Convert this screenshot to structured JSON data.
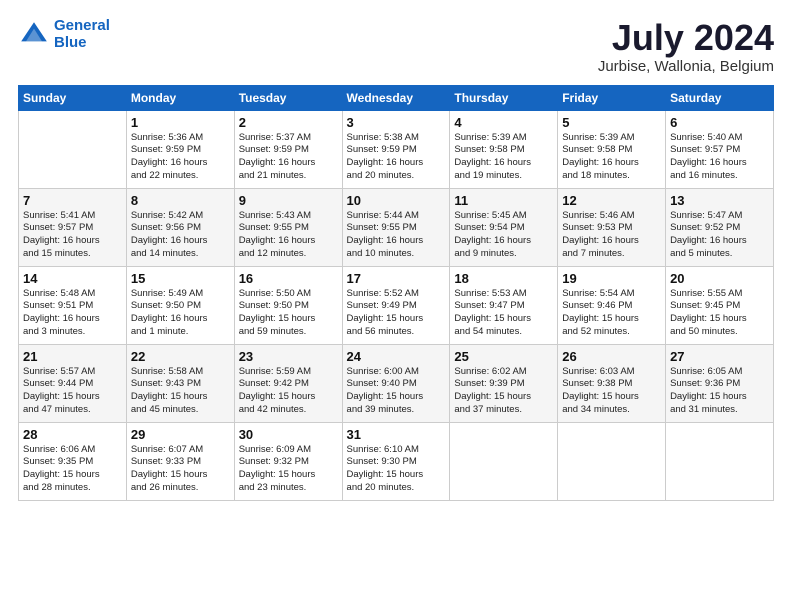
{
  "header": {
    "logo_line1": "General",
    "logo_line2": "Blue",
    "title": "July 2024",
    "subtitle": "Jurbise, Wallonia, Belgium"
  },
  "days_of_week": [
    "Sunday",
    "Monday",
    "Tuesday",
    "Wednesday",
    "Thursday",
    "Friday",
    "Saturday"
  ],
  "weeks": [
    [
      {
        "day": "",
        "text": ""
      },
      {
        "day": "1",
        "text": "Sunrise: 5:36 AM\nSunset: 9:59 PM\nDaylight: 16 hours\nand 22 minutes."
      },
      {
        "day": "2",
        "text": "Sunrise: 5:37 AM\nSunset: 9:59 PM\nDaylight: 16 hours\nand 21 minutes."
      },
      {
        "day": "3",
        "text": "Sunrise: 5:38 AM\nSunset: 9:59 PM\nDaylight: 16 hours\nand 20 minutes."
      },
      {
        "day": "4",
        "text": "Sunrise: 5:39 AM\nSunset: 9:58 PM\nDaylight: 16 hours\nand 19 minutes."
      },
      {
        "day": "5",
        "text": "Sunrise: 5:39 AM\nSunset: 9:58 PM\nDaylight: 16 hours\nand 18 minutes."
      },
      {
        "day": "6",
        "text": "Sunrise: 5:40 AM\nSunset: 9:57 PM\nDaylight: 16 hours\nand 16 minutes."
      }
    ],
    [
      {
        "day": "7",
        "text": "Sunrise: 5:41 AM\nSunset: 9:57 PM\nDaylight: 16 hours\nand 15 minutes."
      },
      {
        "day": "8",
        "text": "Sunrise: 5:42 AM\nSunset: 9:56 PM\nDaylight: 16 hours\nand 14 minutes."
      },
      {
        "day": "9",
        "text": "Sunrise: 5:43 AM\nSunset: 9:55 PM\nDaylight: 16 hours\nand 12 minutes."
      },
      {
        "day": "10",
        "text": "Sunrise: 5:44 AM\nSunset: 9:55 PM\nDaylight: 16 hours\nand 10 minutes."
      },
      {
        "day": "11",
        "text": "Sunrise: 5:45 AM\nSunset: 9:54 PM\nDaylight: 16 hours\nand 9 minutes."
      },
      {
        "day": "12",
        "text": "Sunrise: 5:46 AM\nSunset: 9:53 PM\nDaylight: 16 hours\nand 7 minutes."
      },
      {
        "day": "13",
        "text": "Sunrise: 5:47 AM\nSunset: 9:52 PM\nDaylight: 16 hours\nand 5 minutes."
      }
    ],
    [
      {
        "day": "14",
        "text": "Sunrise: 5:48 AM\nSunset: 9:51 PM\nDaylight: 16 hours\nand 3 minutes."
      },
      {
        "day": "15",
        "text": "Sunrise: 5:49 AM\nSunset: 9:50 PM\nDaylight: 16 hours\nand 1 minute."
      },
      {
        "day": "16",
        "text": "Sunrise: 5:50 AM\nSunset: 9:50 PM\nDaylight: 15 hours\nand 59 minutes."
      },
      {
        "day": "17",
        "text": "Sunrise: 5:52 AM\nSunset: 9:49 PM\nDaylight: 15 hours\nand 56 minutes."
      },
      {
        "day": "18",
        "text": "Sunrise: 5:53 AM\nSunset: 9:47 PM\nDaylight: 15 hours\nand 54 minutes."
      },
      {
        "day": "19",
        "text": "Sunrise: 5:54 AM\nSunset: 9:46 PM\nDaylight: 15 hours\nand 52 minutes."
      },
      {
        "day": "20",
        "text": "Sunrise: 5:55 AM\nSunset: 9:45 PM\nDaylight: 15 hours\nand 50 minutes."
      }
    ],
    [
      {
        "day": "21",
        "text": "Sunrise: 5:57 AM\nSunset: 9:44 PM\nDaylight: 15 hours\nand 47 minutes."
      },
      {
        "day": "22",
        "text": "Sunrise: 5:58 AM\nSunset: 9:43 PM\nDaylight: 15 hours\nand 45 minutes."
      },
      {
        "day": "23",
        "text": "Sunrise: 5:59 AM\nSunset: 9:42 PM\nDaylight: 15 hours\nand 42 minutes."
      },
      {
        "day": "24",
        "text": "Sunrise: 6:00 AM\nSunset: 9:40 PM\nDaylight: 15 hours\nand 39 minutes."
      },
      {
        "day": "25",
        "text": "Sunrise: 6:02 AM\nSunset: 9:39 PM\nDaylight: 15 hours\nand 37 minutes."
      },
      {
        "day": "26",
        "text": "Sunrise: 6:03 AM\nSunset: 9:38 PM\nDaylight: 15 hours\nand 34 minutes."
      },
      {
        "day": "27",
        "text": "Sunrise: 6:05 AM\nSunset: 9:36 PM\nDaylight: 15 hours\nand 31 minutes."
      }
    ],
    [
      {
        "day": "28",
        "text": "Sunrise: 6:06 AM\nSunset: 9:35 PM\nDaylight: 15 hours\nand 28 minutes."
      },
      {
        "day": "29",
        "text": "Sunrise: 6:07 AM\nSunset: 9:33 PM\nDaylight: 15 hours\nand 26 minutes."
      },
      {
        "day": "30",
        "text": "Sunrise: 6:09 AM\nSunset: 9:32 PM\nDaylight: 15 hours\nand 23 minutes."
      },
      {
        "day": "31",
        "text": "Sunrise: 6:10 AM\nSunset: 9:30 PM\nDaylight: 15 hours\nand 20 minutes."
      },
      {
        "day": "",
        "text": ""
      },
      {
        "day": "",
        "text": ""
      },
      {
        "day": "",
        "text": ""
      }
    ]
  ]
}
